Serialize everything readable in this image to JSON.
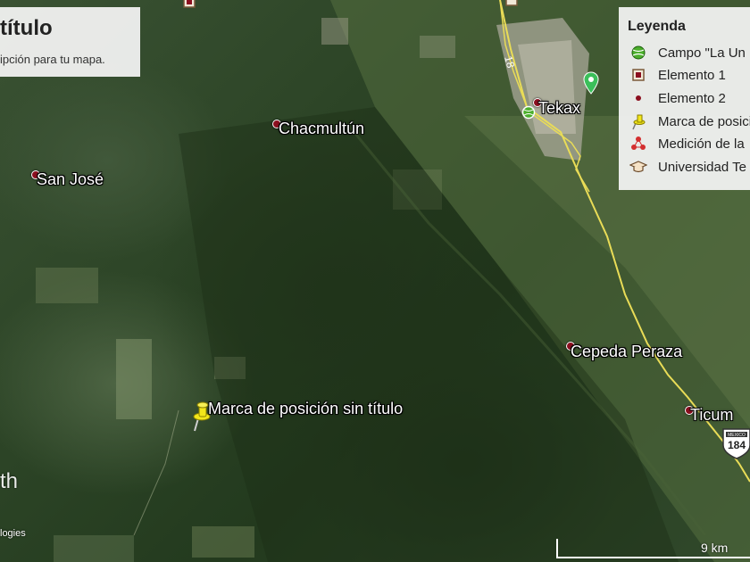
{
  "map_title": {
    "title": "título",
    "description": "ipción para tu mapa."
  },
  "legend": {
    "heading": "Leyenda",
    "items": [
      {
        "icon": "ball-icon",
        "label": "Campo \"La Un"
      },
      {
        "icon": "square-marker-icon",
        "label": "Elemento 1"
      },
      {
        "icon": "red-dot-icon",
        "label": "Elemento 2"
      },
      {
        "icon": "yellow-pushpin-icon",
        "label": "Marca de posici"
      },
      {
        "icon": "measurement-icon",
        "label": "Medición de la"
      },
      {
        "icon": "graduation-cap-icon",
        "label": "Universidad Te"
      }
    ]
  },
  "places": {
    "chacmultun": "Chacmultún",
    "san_jose": "San José",
    "tekax": "Tekax",
    "cepeda_peraza": "Cepeda Peraza",
    "ticum": "Ticum",
    "pin_label": "Marca de posición sin título"
  },
  "roads": {
    "road_number": "18",
    "route_shield_number": "184",
    "shield_top_text": "MEXICO"
  },
  "scale_bar": {
    "label": "9 km"
  },
  "corner_text": {
    "watermark_fragment": "th",
    "attribution": "logies"
  },
  "colors": {
    "road": "#e9dc57",
    "place_dot": "#8b0f1f",
    "pushpin": "#f2e61a",
    "ball": "#4caf2c",
    "measurement": "#d32f2f",
    "green_pin": "#3bbf5a"
  }
}
